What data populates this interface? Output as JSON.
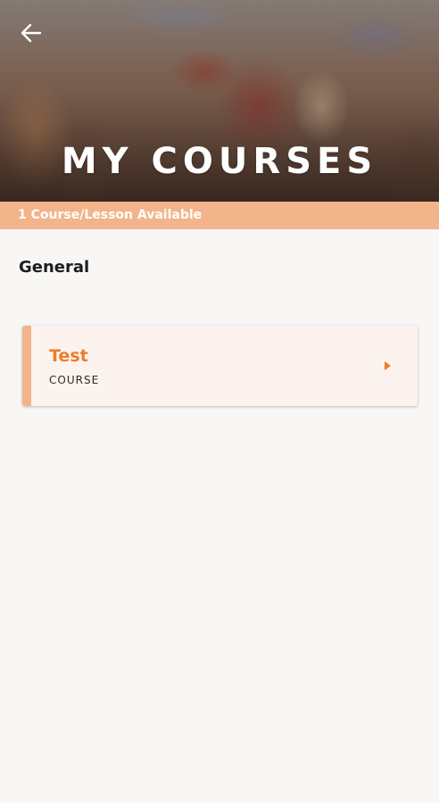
{
  "header": {
    "title": "MY COURSES",
    "back_icon": "arrow-left-icon",
    "availability_text": "1 Course/Lesson Available"
  },
  "section": {
    "title": "General"
  },
  "courses": [
    {
      "title": "Test",
      "type": "COURSE",
      "icon": "chevron-right-icon"
    }
  ],
  "colors": {
    "accent": "#ea7d2c",
    "accent_light": "#f2b48a",
    "card_bg": "#fcf3ee",
    "page_bg": "#f8f7f6"
  }
}
